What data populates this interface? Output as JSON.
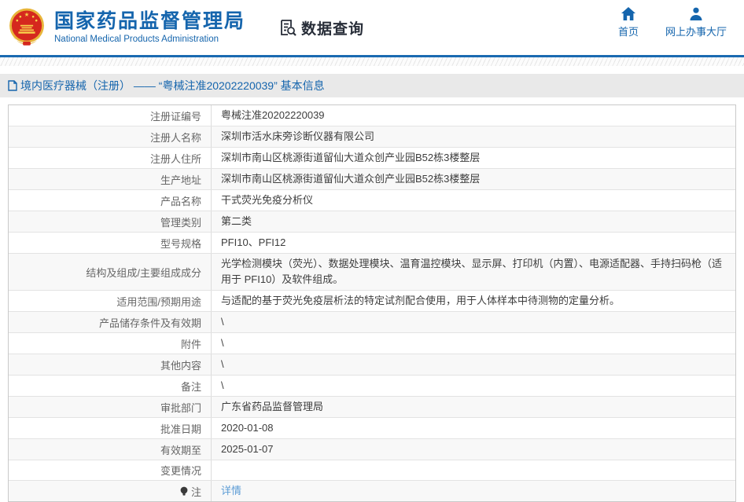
{
  "header": {
    "logo": {
      "title": "国家药品监督管理局",
      "subtitle": "National Medical Products Administration",
      "emblem_icon": "national-emblem-icon"
    },
    "section_title": "数据查询",
    "section_icon": "document-search-icon",
    "nav": [
      {
        "label": "首页",
        "icon": "home-icon"
      },
      {
        "label": "网上办事大厅",
        "icon": "user-icon"
      }
    ]
  },
  "breadcrumb": {
    "icon": "document-icon",
    "text": "境内医疗器械（注册） —— “粤械注准20202220039” 基本信息"
  },
  "table": {
    "rows": [
      {
        "label": "注册证编号",
        "value": "粤械注准20202220039"
      },
      {
        "label": "注册人名称",
        "value": "深圳市活水床旁诊断仪器有限公司"
      },
      {
        "label": "注册人住所",
        "value": "深圳市南山区桃源街道留仙大道众创产业园B52栋3楼整层"
      },
      {
        "label": "生产地址",
        "value": "深圳市南山区桃源街道留仙大道众创产业园B52栋3楼整层"
      },
      {
        "label": "产品名称",
        "value": "干式荧光免疫分析仪"
      },
      {
        "label": "管理类别",
        "value": "第二类"
      },
      {
        "label": "型号规格",
        "value": "PFI10、PFI12"
      },
      {
        "label": "结构及组成/主要组成成分",
        "value": "光学检测模块（荧光）、数据处理模块、温育温控模块、显示屏、打印机（内置）、电源适配器、手持扫码枪（适用于 PFI10）及软件组成。"
      },
      {
        "label": "适用范围/预期用途",
        "value": "与适配的基于荧光免疫层析法的特定试剂配合使用，用于人体样本中待测物的定量分析。"
      },
      {
        "label": "产品储存条件及有效期",
        "value": "\\"
      },
      {
        "label": "附件",
        "value": "\\"
      },
      {
        "label": "其他内容",
        "value": "\\"
      },
      {
        "label": "备注",
        "value": "\\"
      },
      {
        "label": "审批部门",
        "value": "广东省药品监督管理局"
      },
      {
        "label": "批准日期",
        "value": "2020-01-08"
      },
      {
        "label": "有效期至",
        "value": "2025-01-07"
      },
      {
        "label": "变更情况",
        "value": ""
      },
      {
        "label": "注",
        "value": "详情",
        "link": true,
        "label_icon": "bulb-icon"
      }
    ]
  },
  "colors": {
    "brand_blue": "#1565ad",
    "header_rule_blue": "#1a6ab1",
    "breadcrumb_band": "#e9e9e9",
    "row_alt": "#f8f8f8",
    "table_border": "#c9c9c9",
    "label_text": "#666666",
    "value_text": "#3d3d3d",
    "link_blue": "#5b9bd5",
    "emblem_red": "#d5281e",
    "emblem_gold": "#e8b53a"
  }
}
